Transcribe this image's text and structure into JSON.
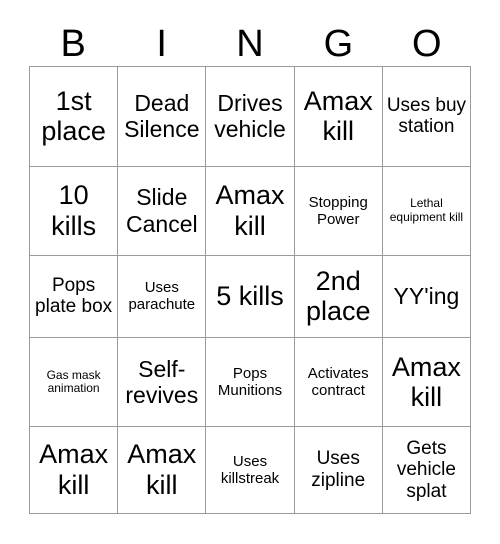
{
  "card": {
    "type": "bingo-card",
    "columns": 5,
    "rows": 5,
    "background_color": "#ffffff",
    "text_color": "#000000",
    "border_color": "#9a9a9a"
  },
  "header": {
    "letters": [
      "B",
      "I",
      "N",
      "G",
      "O"
    ]
  },
  "grid": {
    "rows": [
      [
        {
          "text": "1st place",
          "size": "fs-xl"
        },
        {
          "text": "Dead Silence",
          "size": "fs-lg"
        },
        {
          "text": "Drives vehicle",
          "size": "fs-lg"
        },
        {
          "text": "Amax kill",
          "size": "fs-xl"
        },
        {
          "text": "Uses buy station",
          "size": "fs-md"
        }
      ],
      [
        {
          "text": "10 kills",
          "size": "fs-xl"
        },
        {
          "text": "Slide Cancel",
          "size": "fs-lg"
        },
        {
          "text": "Amax kill",
          "size": "fs-xl"
        },
        {
          "text": "Stopping Power",
          "size": "fs-sm"
        },
        {
          "text": "Lethal equipment kill",
          "size": "fs-xs"
        }
      ],
      [
        {
          "text": "Pops plate box",
          "size": "fs-md"
        },
        {
          "text": "Uses parachute",
          "size": "fs-sm"
        },
        {
          "text": "5 kills",
          "size": "fs-xl"
        },
        {
          "text": "2nd place",
          "size": "fs-xl"
        },
        {
          "text": "YY'ing",
          "size": "fs-lg"
        }
      ],
      [
        {
          "text": "Gas mask animation",
          "size": "fs-xs"
        },
        {
          "text": "Self-revives",
          "size": "fs-lg"
        },
        {
          "text": "Pops Munitions",
          "size": "fs-sm"
        },
        {
          "text": "Activates contract",
          "size": "fs-sm"
        },
        {
          "text": "Amax kill",
          "size": "fs-xl"
        }
      ],
      [
        {
          "text": "Amax kill",
          "size": "fs-xl"
        },
        {
          "text": "Amax kill",
          "size": "fs-xl"
        },
        {
          "text": "Uses killstreak",
          "size": "fs-sm"
        },
        {
          "text": "Uses zipline",
          "size": "fs-md"
        },
        {
          "text": "Gets vehicle splat",
          "size": "fs-md"
        }
      ]
    ]
  }
}
